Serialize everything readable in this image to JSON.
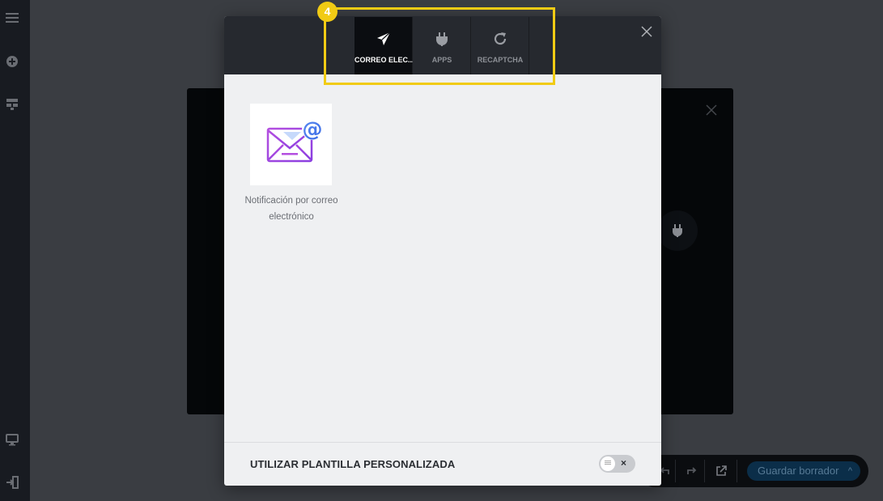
{
  "modal": {
    "tabs": [
      {
        "label": "CORREO ELEC...",
        "icon": "paper-plane-icon",
        "active": true
      },
      {
        "label": "APPS",
        "icon": "plug-icon",
        "active": false
      },
      {
        "label": "RECAPTCHA",
        "icon": "refresh-icon",
        "active": false
      }
    ],
    "cards": [
      {
        "label": "Notificación por correo electrónico",
        "icon": "email-notification-icon"
      }
    ],
    "footer": {
      "template_label": "UTILIZAR PLANTILLA PERSONALIZADA",
      "toggle_state": "off",
      "toggle_glyph": "×"
    }
  },
  "bottom_bar": {
    "save_label": "Guardar borrador",
    "chevron": "^"
  },
  "annotation": {
    "badge": "4",
    "color": "#f1cb14"
  },
  "colors": {
    "header_bg": "#26292f",
    "active_tab_bg": "#0b0d11",
    "modal_bg": "#eff0f2",
    "save_button_bg": "#0b2e49"
  }
}
